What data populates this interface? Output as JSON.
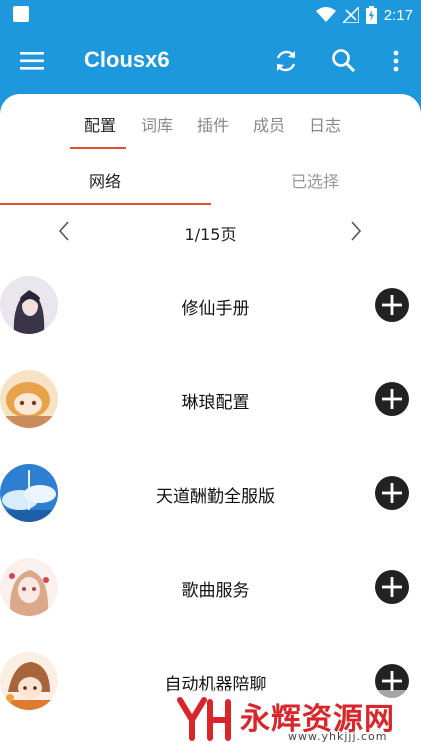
{
  "status_bar": {
    "time": "2:17",
    "icons": [
      "app-notification-icon",
      "wifi-icon",
      "signal-icon",
      "battery-charging-icon"
    ]
  },
  "toolbar": {
    "title": "Clousx6",
    "icons": [
      "menu-icon",
      "refresh-icon",
      "search-icon",
      "more-vert-icon"
    ]
  },
  "top_tabs": [
    {
      "label": "配置",
      "active": true
    },
    {
      "label": "词库",
      "active": false
    },
    {
      "label": "插件",
      "active": false
    },
    {
      "label": "成员",
      "active": false
    },
    {
      "label": "日志",
      "active": false
    }
  ],
  "sub_tabs": [
    {
      "label": "网络",
      "active": true
    },
    {
      "label": "已选择",
      "active": false
    }
  ],
  "pager": {
    "label": "1/15页"
  },
  "items": [
    {
      "name": "修仙手册"
    },
    {
      "name": "琳琅配置"
    },
    {
      "name": "天道酬勤全服版"
    },
    {
      "name": "歌曲服务"
    },
    {
      "name": "自动机器陪聊"
    }
  ],
  "watermark": {
    "text": "永辉资源网",
    "url": "www.yhkjjj.com"
  },
  "colors": {
    "primary": "#1e98dc",
    "accent": "#e0522b",
    "add_button": "#222222"
  }
}
